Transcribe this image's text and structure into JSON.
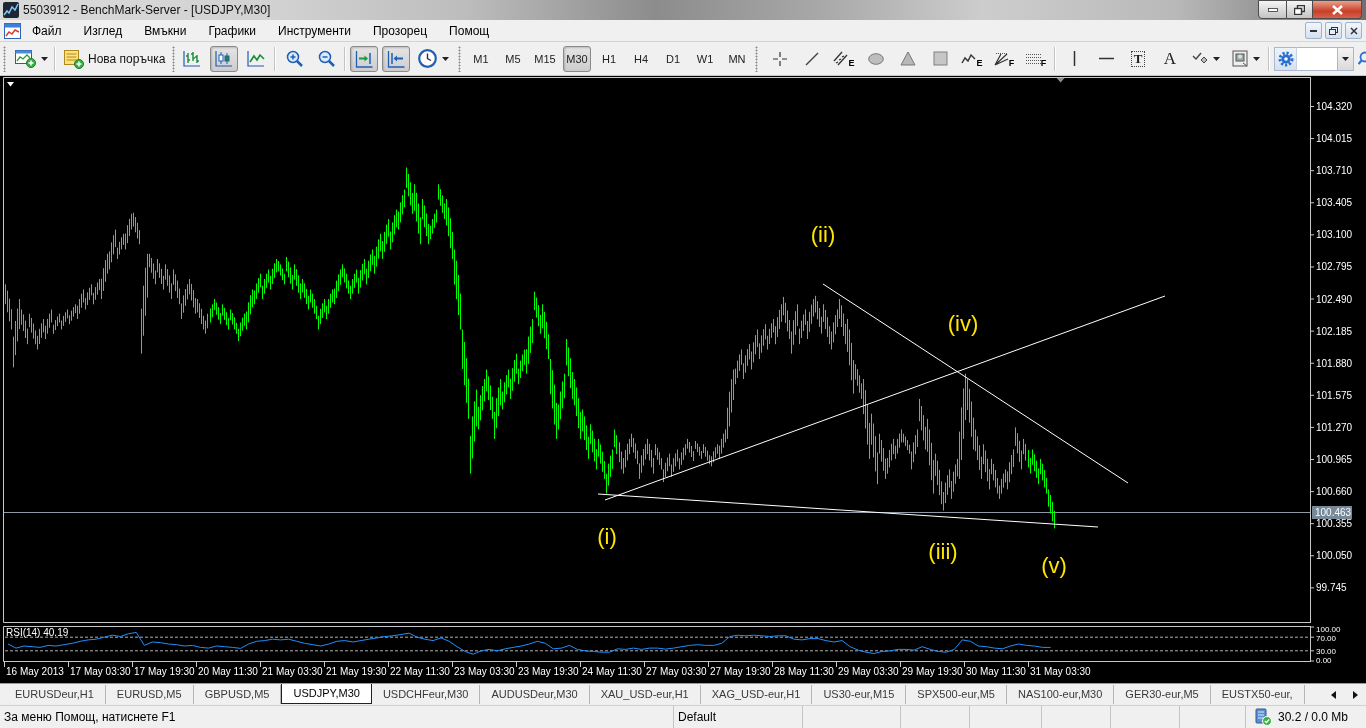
{
  "window": {
    "title": "5503912 - BenchMark-Server - [USDJPY,M30]"
  },
  "menu": [
    "Файл",
    "Изглед",
    "Вмъкни",
    "Графики",
    "Инструменти",
    "Прозорец",
    "Помощ"
  ],
  "toolbar": {
    "order_button": {
      "label": "Нова поръчка"
    },
    "chart_types": [
      {
        "kind": "bars",
        "selected": false
      },
      {
        "kind": "candles",
        "selected": true
      },
      {
        "kind": "line",
        "selected": false
      }
    ],
    "chart_modes": [
      {
        "kind": "shift",
        "on": true
      },
      {
        "kind": "autoscroll",
        "on": true
      }
    ],
    "timeframes": [
      {
        "label": "M1",
        "selected": false
      },
      {
        "label": "M5",
        "selected": false
      },
      {
        "label": "M15",
        "selected": false
      },
      {
        "label": "M30",
        "selected": true
      },
      {
        "label": "H1",
        "selected": false
      },
      {
        "label": "H4",
        "selected": false
      },
      {
        "label": "D1",
        "selected": false
      },
      {
        "label": "W1",
        "selected": false
      },
      {
        "label": "MN",
        "selected": false
      }
    ],
    "drawing_tools": [
      {
        "kind": "crosshair"
      },
      {
        "kind": "trendline"
      },
      {
        "kind": "channel",
        "badge": "E"
      },
      {
        "kind": "ellipse"
      },
      {
        "kind": "triangle"
      },
      {
        "kind": "rectangle"
      },
      {
        "kind": "zigzag",
        "badge": "E"
      },
      {
        "kind": "fan",
        "badge": "F"
      },
      {
        "kind": "levels",
        "badge": "F"
      }
    ],
    "object_tools": [
      {
        "kind": "vline"
      },
      {
        "kind": "hline"
      },
      {
        "kind": "label",
        "glyph": "T"
      },
      {
        "kind": "text",
        "glyph": "A"
      },
      {
        "kind": "arrows"
      },
      {
        "kind": "template"
      }
    ]
  },
  "chart": {
    "price_pane": {
      "wave_labels": [
        "(ii)",
        "(iv)",
        "(i)",
        "(iii)",
        "(v)"
      ],
      "price_scale": [
        "104.320",
        "104.015",
        "103.710",
        "103.405",
        "103.100",
        "102.795",
        "102.490",
        "102.185",
        "101.880",
        "101.575",
        "101.270",
        "100.965",
        "100.660",
        "100.355",
        "100.050",
        "99.745"
      ],
      "bid_price": "100.463"
    },
    "indicator_pane": {
      "name": "RSI(14)",
      "reading": "40.19",
      "scale": [
        "100.00",
        "70.00",
        "30.00",
        "0.00"
      ]
    },
    "time_scale": [
      "16 May 2013",
      "17 May 03:30",
      "17 May 19:30",
      "20 May 11:30",
      "21 May 03:30",
      "21 May 19:30",
      "22 May 11:30",
      "23 May 03:30",
      "23 May 19:30",
      "24 May 11:30",
      "27 May 03:30",
      "27 May 19:30",
      "28 May 11:30",
      "29 May 03:30",
      "29 May 19:30",
      "30 May 11:30",
      "31 May 03:30"
    ]
  },
  "symbol_tabs": [
    {
      "label": "EURUSDeur,H1",
      "selected": false
    },
    {
      "label": "EURUSD,M5",
      "selected": false
    },
    {
      "label": "GBPUSD,M5",
      "selected": false
    },
    {
      "label": "USDJPY,M30",
      "selected": true
    },
    {
      "label": "USDCHFeur,M30",
      "selected": false
    },
    {
      "label": "AUDUSDeur,M30",
      "selected": false
    },
    {
      "label": "XAU_USD-eur,H1",
      "selected": false
    },
    {
      "label": "XAG_USD-eur,H1",
      "selected": false
    },
    {
      "label": "US30-eur,M15",
      "selected": false
    },
    {
      "label": "SPX500-eur,M5",
      "selected": false
    },
    {
      "label": "NAS100-eur,M30",
      "selected": false
    },
    {
      "label": "GER30-eur,M5",
      "selected": false
    },
    {
      "label": "EUSTX50-eur,",
      "selected": false
    }
  ],
  "status_bar": {
    "hint": "За меню Помощ, натиснете F1",
    "profile": "Default",
    "traffic": "30.2 / 0.0 Mb"
  }
}
